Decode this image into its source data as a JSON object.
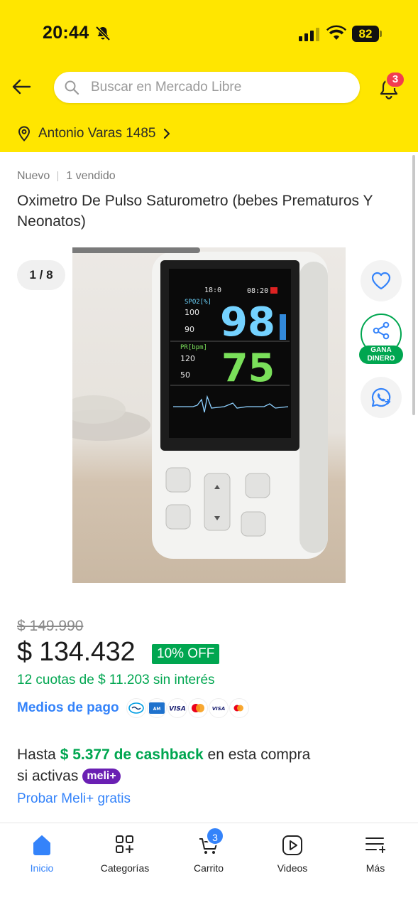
{
  "status_bar": {
    "time": "20:44",
    "battery": "82"
  },
  "header": {
    "search_placeholder": "Buscar en Mercado Libre",
    "notification_count": "3",
    "address": "Antonio Varas 1485"
  },
  "product": {
    "condition": "Nuevo",
    "sold": "1 vendido",
    "title": "Oximetro De Pulso Saturometro (bebes Prematuros Y Neonatos)",
    "image_counter": "1 / 8",
    "gallery_progress": 0.125,
    "device_screen": {
      "time1": "18:0",
      "time2": "08:20",
      "spo2_label": "SPO2[%]",
      "spo2_hi": "100",
      "spo2_lo": "90",
      "spo2_value": "98",
      "pr_label": "PR[bpm]",
      "pr_hi": "120",
      "pr_lo": "50",
      "pr_value": "75"
    }
  },
  "actions": {
    "favorite_icon": "heart-icon",
    "share_icon": "share-icon",
    "share_label": "GANA DINERO",
    "whatsapp_icon": "whatsapp-icon"
  },
  "price": {
    "old": "$ 149.990",
    "current": "$ 134.432",
    "discount": "10% OFF",
    "installments": "12 cuotas de $ 11.203 sin interés",
    "payment_link": "Medios de pago"
  },
  "cashback": {
    "prefix": "Hasta",
    "amount": "$ 5.377 de cashback",
    "suffix": "en esta compra",
    "line2": "si activas",
    "badge": "meli+",
    "trial_link": "Probar Meli+ gratis"
  },
  "bottom_nav": {
    "items": [
      {
        "label": "Inicio"
      },
      {
        "label": "Categorías"
      },
      {
        "label": "Carrito"
      },
      {
        "label": "Videos"
      },
      {
        "label": "Más"
      }
    ],
    "cart_count": "3"
  },
  "colors": {
    "brand_yellow": "#ffe600",
    "green": "#00a650",
    "link_blue": "#3483fa",
    "badge_red": "#f23d4f",
    "meli_purple": "#6a1fb3"
  }
}
